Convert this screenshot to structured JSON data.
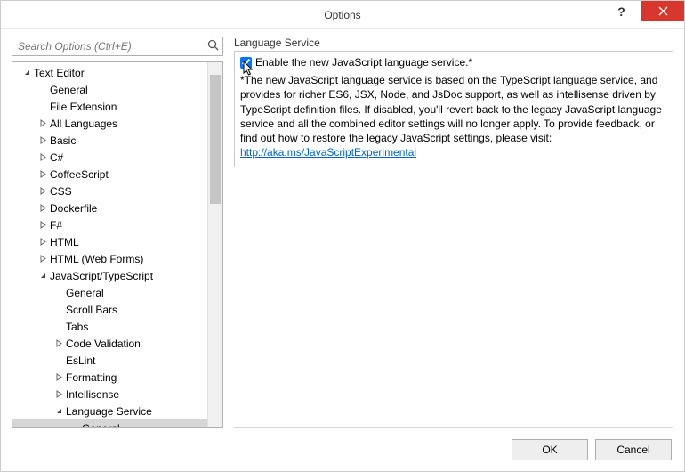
{
  "window": {
    "title": "Options",
    "help_tooltip": "?",
    "close_tooltip": "Close"
  },
  "search": {
    "placeholder": "Search Options (Ctrl+E)"
  },
  "tree": [
    {
      "depth": 0,
      "expander": "open",
      "label": "Text Editor"
    },
    {
      "depth": 1,
      "expander": "none",
      "label": "General"
    },
    {
      "depth": 1,
      "expander": "none",
      "label": "File Extension"
    },
    {
      "depth": 1,
      "expander": "closed",
      "label": "All Languages"
    },
    {
      "depth": 1,
      "expander": "closed",
      "label": "Basic"
    },
    {
      "depth": 1,
      "expander": "closed",
      "label": "C#"
    },
    {
      "depth": 1,
      "expander": "closed",
      "label": "CoffeeScript"
    },
    {
      "depth": 1,
      "expander": "closed",
      "label": "CSS"
    },
    {
      "depth": 1,
      "expander": "closed",
      "label": "Dockerfile"
    },
    {
      "depth": 1,
      "expander": "closed",
      "label": "F#"
    },
    {
      "depth": 1,
      "expander": "closed",
      "label": "HTML"
    },
    {
      "depth": 1,
      "expander": "closed",
      "label": "HTML (Web Forms)"
    },
    {
      "depth": 1,
      "expander": "open",
      "label": "JavaScript/TypeScript"
    },
    {
      "depth": 2,
      "expander": "none",
      "label": "General"
    },
    {
      "depth": 2,
      "expander": "none",
      "label": "Scroll Bars"
    },
    {
      "depth": 2,
      "expander": "none",
      "label": "Tabs"
    },
    {
      "depth": 2,
      "expander": "closed",
      "label": "Code Validation"
    },
    {
      "depth": 2,
      "expander": "none",
      "label": "EsLint"
    },
    {
      "depth": 2,
      "expander": "closed",
      "label": "Formatting"
    },
    {
      "depth": 2,
      "expander": "closed",
      "label": "Intellisense"
    },
    {
      "depth": 2,
      "expander": "open",
      "label": "Language Service"
    },
    {
      "depth": 3,
      "expander": "none",
      "label": "General",
      "selected": true
    }
  ],
  "panel": {
    "group_label": "Language Service",
    "checkbox_label": "Enable the new JavaScript language service.*",
    "checkbox_checked": true,
    "description_before_link": "*The new JavaScript language service is based on the TypeScript language service, and provides for richer ES6, JSX, Node, and JsDoc support, as well as intellisense driven by TypeScript definition files. If disabled, you'll revert back to the legacy JavaScript language service and all the combined editor settings will no longer apply. To provide feedback, or find out how to restore the legacy JavaScript settings, please visit: ",
    "link_text": "http://aka.ms/JavaScriptExperimental"
  },
  "buttons": {
    "ok": "OK",
    "cancel": "Cancel"
  }
}
